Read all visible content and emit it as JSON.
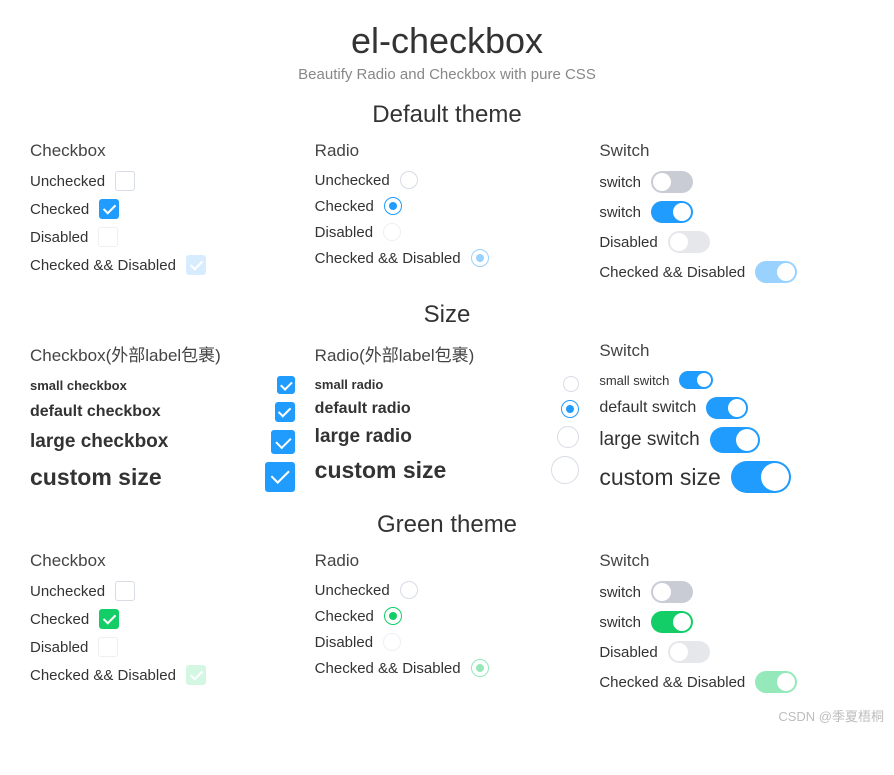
{
  "header": {
    "title": "el-checkbox",
    "subtitle": "Beautify Radio and Checkbox with pure CSS"
  },
  "sections": {
    "default": "Default theme",
    "size": "Size",
    "green": "Green theme"
  },
  "col_headers": {
    "checkbox": "Checkbox",
    "radio": "Radio",
    "switch": "Switch",
    "checkbox_wrap": "Checkbox(外部label包裹)",
    "radio_wrap": "Radio(外部label包裹)"
  },
  "labels": {
    "unchecked": "Unchecked",
    "checked": "Checked",
    "disabled": "Disabled",
    "checked_disabled": "Checked && Disabled",
    "switch": "switch",
    "switch_cap": "Switch",
    "small_checkbox": "small checkbox",
    "default_checkbox": "default checkbox",
    "large_checkbox": "large checkbox",
    "custom_size": "custom size",
    "small_radio": "small radio",
    "default_radio": "default radio",
    "large_radio": "large radio",
    "small_switch": "small switch",
    "default_switch": "default switch",
    "large_switch": "large switch"
  },
  "watermark": "CSDN @季夏梧桐"
}
